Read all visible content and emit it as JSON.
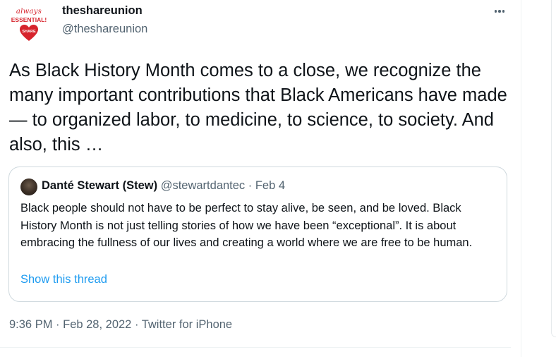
{
  "author": {
    "avatar_text_top": "always",
    "avatar_text_mid": "ESSENTIAL!",
    "avatar_text_heart": "SHARE",
    "name": "theshareunion",
    "handle": "@theshareunion"
  },
  "more_icon": "more-horizontal-icon",
  "tweet": {
    "text": "As Black History Month comes to a close, we recognize the many important contributions that Black Americans have made — to organized labor, to medicine, to science, to society. And also, this …"
  },
  "quoted_tweet": {
    "name": "Danté Stewart (Stew)",
    "meta": " @stewartdantec · Feb 4",
    "text": "Black people should not have to be perfect to stay alive, be seen, and be loved. Black History Month is not just telling stories of how we have been “exceptional”. It is about embracing the fullness of our lives and creating a world where we are free to be human.",
    "thread_link": "Show this thread"
  },
  "timestamp": "9:36 PM · Feb 28, 2022 · Twitter for iPhone",
  "colors": {
    "text": "#0f1419",
    "secondary": "#536471",
    "link": "#1d9bf0",
    "border": "#cfd9de",
    "brand_red": "#d6232c"
  }
}
